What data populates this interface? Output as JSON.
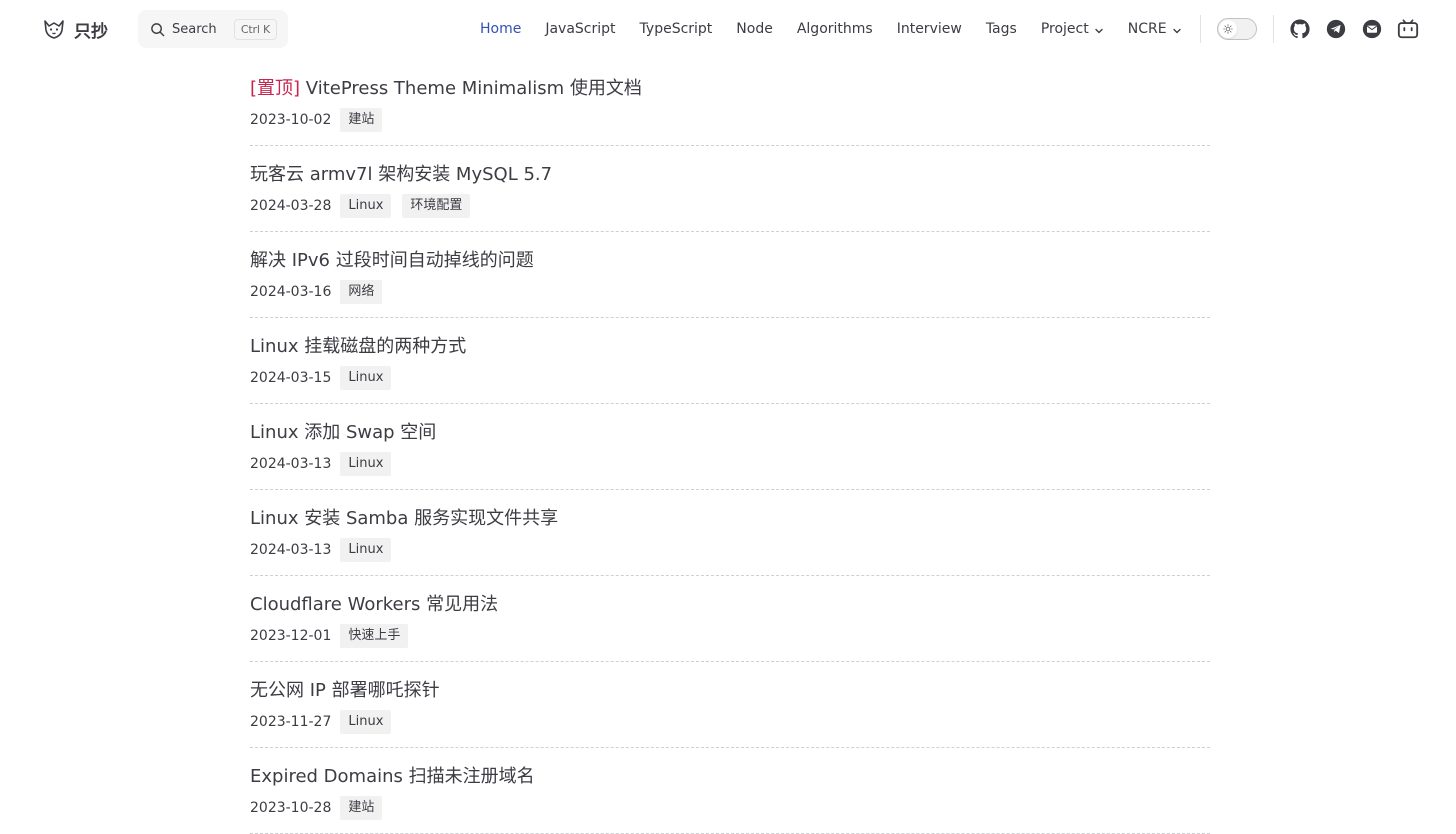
{
  "brand": {
    "title": "只抄"
  },
  "search": {
    "label": "Search",
    "shortcut": "Ctrl K"
  },
  "nav": {
    "items": [
      {
        "label": "Home",
        "active": true,
        "dropdown": false
      },
      {
        "label": "JavaScript",
        "active": false,
        "dropdown": false
      },
      {
        "label": "TypeScript",
        "active": false,
        "dropdown": false
      },
      {
        "label": "Node",
        "active": false,
        "dropdown": false
      },
      {
        "label": "Algorithms",
        "active": false,
        "dropdown": false
      },
      {
        "label": "Interview",
        "active": false,
        "dropdown": false
      },
      {
        "label": "Tags",
        "active": false,
        "dropdown": false
      },
      {
        "label": "Project",
        "active": false,
        "dropdown": true
      },
      {
        "label": "NCRE",
        "active": false,
        "dropdown": true
      }
    ],
    "active_color": "#3451b2"
  },
  "social": [
    "github-icon",
    "telegram-icon",
    "mail-icon",
    "bilibili-icon"
  ],
  "posts": [
    {
      "pinned": true,
      "pin_label": "[置顶]",
      "title": "VitePress Theme Minimalism 使用文档",
      "date": "2023-10-02",
      "tags": [
        "建站"
      ]
    },
    {
      "pinned": false,
      "pin_label": "",
      "title": "玩客云 armv7l 架构安装 MySQL 5.7",
      "date": "2024-03-28",
      "tags": [
        "Linux",
        "环境配置"
      ]
    },
    {
      "pinned": false,
      "pin_label": "",
      "title": "解决 IPv6 过段时间自动掉线的问题",
      "date": "2024-03-16",
      "tags": [
        "网络"
      ]
    },
    {
      "pinned": false,
      "pin_label": "",
      "title": "Linux 挂载磁盘的两种方式",
      "date": "2024-03-15",
      "tags": [
        "Linux"
      ]
    },
    {
      "pinned": false,
      "pin_label": "",
      "title": "Linux 添加 Swap 空间",
      "date": "2024-03-13",
      "tags": [
        "Linux"
      ]
    },
    {
      "pinned": false,
      "pin_label": "",
      "title": "Linux 安装 Samba 服务实现文件共享",
      "date": "2024-03-13",
      "tags": [
        "Linux"
      ]
    },
    {
      "pinned": false,
      "pin_label": "",
      "title": "Cloudflare Workers 常见用法",
      "date": "2023-12-01",
      "tags": [
        "快速上手"
      ]
    },
    {
      "pinned": false,
      "pin_label": "",
      "title": "无公网 IP 部署哪吒探针",
      "date": "2023-11-27",
      "tags": [
        "Linux"
      ]
    },
    {
      "pinned": false,
      "pin_label": "",
      "title": "Expired Domains 扫描未注册域名",
      "date": "2023-10-28",
      "tags": [
        "建站"
      ]
    }
  ]
}
